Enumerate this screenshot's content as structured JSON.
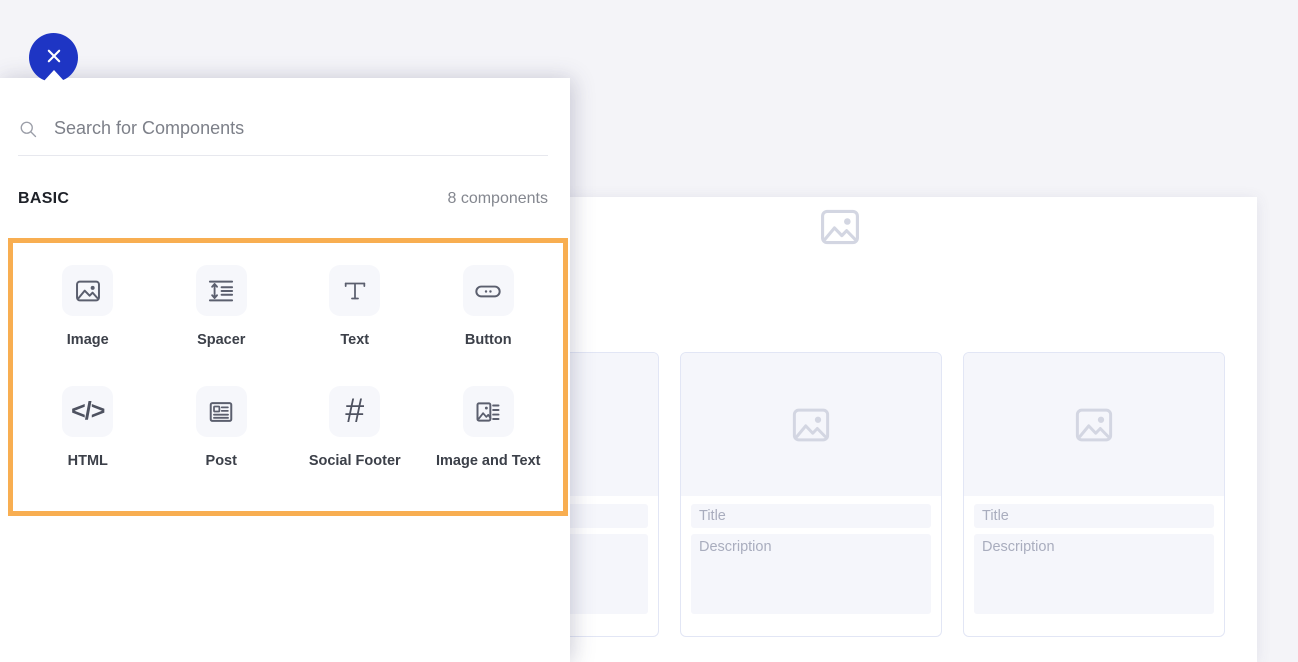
{
  "theme": {
    "page_background": "#f4f4f8",
    "panel_background": "#ffffff",
    "accent_blue": "#1e35c4",
    "highlight_orange": "#f8ae51",
    "tile_background": "#f6f7fb",
    "placeholder_gray": "#d3d6e2",
    "muted_text": "#84878f"
  },
  "panel": {
    "close_button": {
      "name": "close-panel",
      "icon": "close-x-icon",
      "label": "✕"
    },
    "search": {
      "icon": "search-icon",
      "placeholder": "Search for Components",
      "value": ""
    },
    "section": {
      "title": "BASIC",
      "count_label": "8 components"
    },
    "components": [
      {
        "label": "Image",
        "icon": "image-icon"
      },
      {
        "label": "Spacer",
        "icon": "spacer-icon"
      },
      {
        "label": "Text",
        "icon": "text-t-icon"
      },
      {
        "label": "Button",
        "icon": "button-pill-icon"
      },
      {
        "label": "HTML",
        "icon": "code-brackets-icon"
      },
      {
        "label": "Post",
        "icon": "post-article-icon"
      },
      {
        "label": "Social Footer",
        "icon": "hash-icon"
      },
      {
        "label": "Image and Text",
        "icon": "image-and-text-icon"
      }
    ]
  },
  "canvas": {
    "hero_icon": "image-placeholder-icon",
    "cards": [
      {
        "image_icon": "image-placeholder-icon",
        "title": "",
        "description": ""
      },
      {
        "image_icon": "image-placeholder-icon",
        "title": "Title",
        "description": "Description"
      },
      {
        "image_icon": "image-placeholder-icon",
        "title": "Title",
        "description": "Description"
      }
    ]
  }
}
